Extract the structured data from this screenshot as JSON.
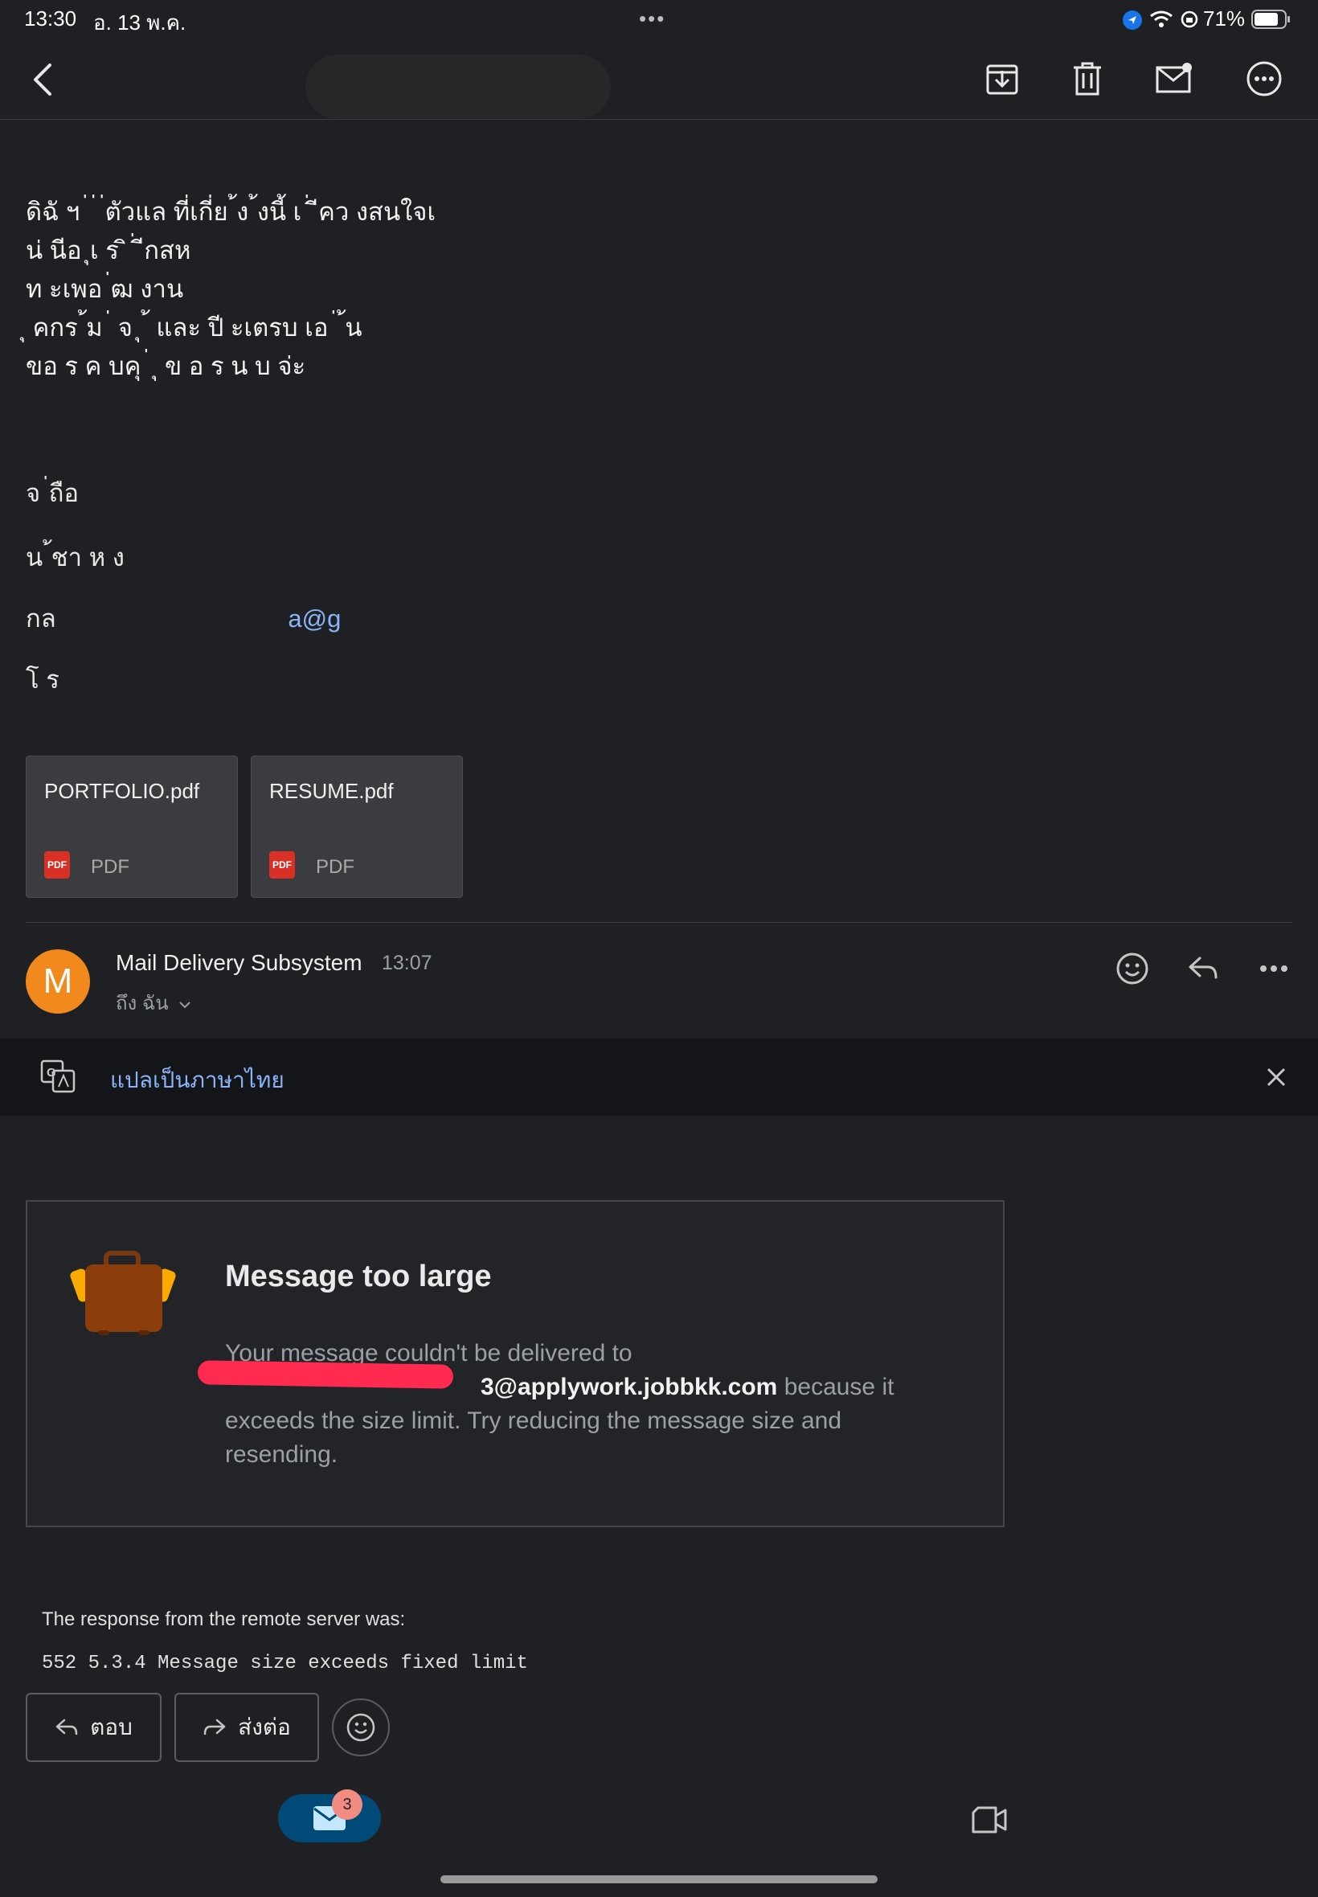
{
  "status_bar": {
    "time": "13:30",
    "date": "อ. 13 พ.ค.",
    "dots": "•••",
    "battery": "71%"
  },
  "email_body": {
    "paragraph_lines": [
      "ดิฉั  ฯ     ่  ่  ่ตัวแล    ที่เกี่ย  ้ง                  ้งนี้  เ   ่  ีคว   งสนใจเ                   ",
      "    น่ นีอ                    ุเ         ร                                                        ิ                ่  ีกสห",
      "               ท                                                                           ะเพอ       ่ฒ  งาน",
      "      ุ       คกร           ้ม          ่  จ                  ุ  ้ และ     ปี            ะเตรบ เอ          ่ ้น      ",
      "ขอ ร ค บคุ  ่                                     ุ    ข อ  ร  น บ        จ่ะ"
    ],
    "signature": {
      "regards": "    จ         ่ถือ",
      "name": "น            ้ชา         ห ง",
      "email_prefix": "  กล  ",
      "email_link": "a@g",
      "phone": "โ ร"
    }
  },
  "attachments": [
    {
      "name": "PORTFOLIO.pdf",
      "type": "PDF",
      "icon_text": "PDF"
    },
    {
      "name": "RESUME.pdf",
      "type": "PDF",
      "icon_text": "PDF"
    }
  ],
  "sender": {
    "avatar_letter": "M",
    "name": "Mail Delivery Subsystem",
    "time": "13:07",
    "to": "ถึง ฉัน"
  },
  "translate_bar": {
    "label": "แปลเป็นภาษาไทย"
  },
  "bounce_card": {
    "title": "Message too large",
    "desc_before": "Your message couldn't be delivered to",
    "address": "3@applywork.jobbkk.com",
    "desc_after": " because it exceeds the size limit. Try reducing the message size and resending."
  },
  "response_label": "The response from the remote server was:",
  "response_code": "552 5.3.4 Message size exceeds fixed limit",
  "actions": {
    "reply": "ตอบ",
    "forward": "ส่งต่อ"
  },
  "bottom_nav": {
    "mail_badge": "3"
  },
  "colors": {
    "background": "#1f2024",
    "link": "#8ab4f8",
    "avatar": "#f2891d",
    "pdf": "#d93025"
  }
}
